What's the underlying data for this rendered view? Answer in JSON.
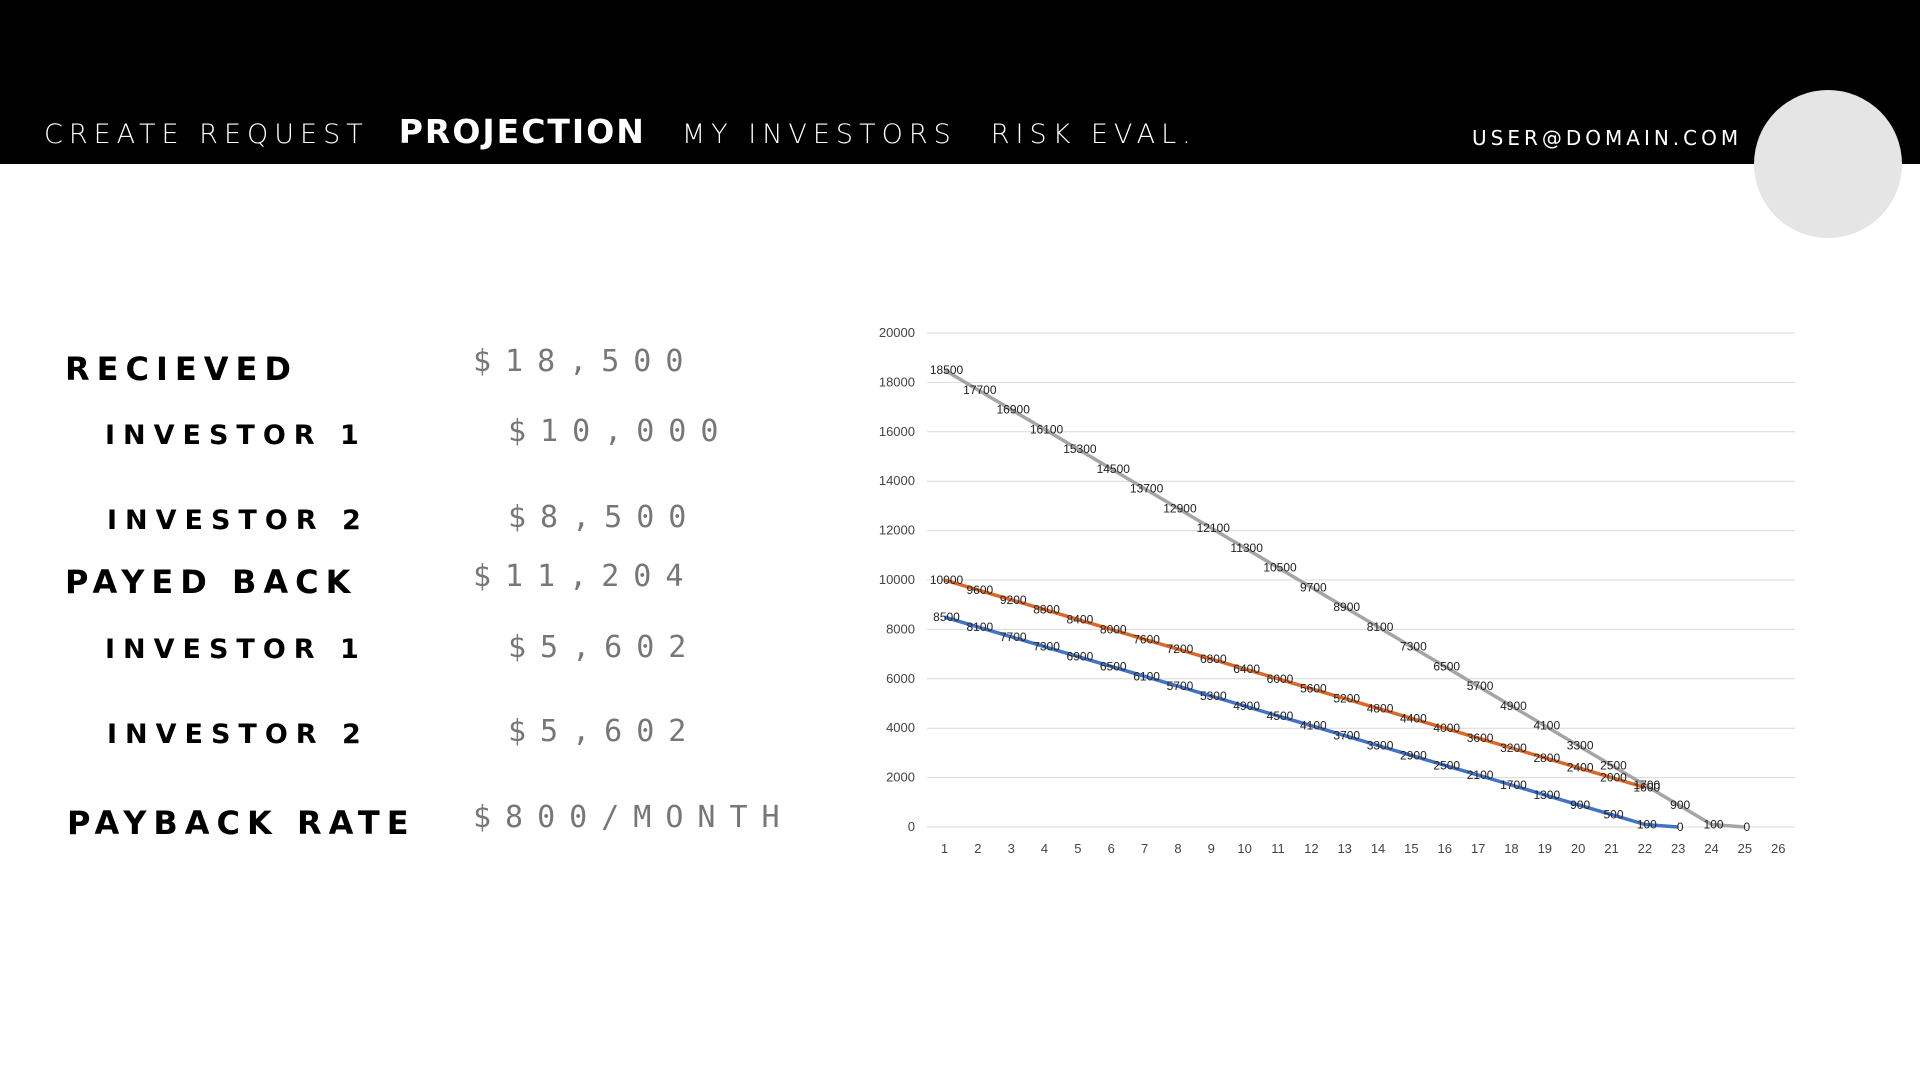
{
  "nav": {
    "items": [
      {
        "label": "CREATE REQUEST",
        "active": false
      },
      {
        "label": "PROJECTION",
        "active": true
      },
      {
        "label": "MY INVESTORS",
        "active": false
      },
      {
        "label": "RISK EVAL.",
        "active": false
      }
    ],
    "user_email": "USER@DOMAIN.COM"
  },
  "summary": {
    "received": {
      "label": "RECIEVED",
      "value": "$18,500"
    },
    "received_investor1": {
      "label": "INVESTOR 1",
      "value": "$10,000"
    },
    "received_investor2": {
      "label": "INVESTOR 2",
      "value": "$8,500"
    },
    "payed_back": {
      "label": "PAYED BACK",
      "value": "$11,204"
    },
    "payed_investor1": {
      "label": "INVESTOR 1",
      "value": "$5,602"
    },
    "payed_investor2": {
      "label": "INVESTOR 2",
      "value": "$5,602"
    },
    "payback_rate": {
      "label": "PAYBACK RATE",
      "value": "$800/MONTH"
    }
  },
  "colors": {
    "topbar": "#000000",
    "series_gray": "#a5a5a5",
    "series_orange": "#d9692a",
    "series_blue": "#4472c4",
    "avatar": "#e5e5e5"
  },
  "chart_data": {
    "type": "line",
    "title": "",
    "xlabel": "",
    "ylabel": "",
    "x": [
      1,
      2,
      3,
      4,
      5,
      6,
      7,
      8,
      9,
      10,
      11,
      12,
      13,
      14,
      15,
      16,
      17,
      18,
      19,
      20,
      21,
      22,
      23,
      24,
      25,
      26
    ],
    "ylim": [
      0,
      20000
    ],
    "yticks": [
      0,
      2000,
      4000,
      6000,
      8000,
      10000,
      12000,
      14000,
      16000,
      18000,
      20000
    ],
    "grid": true,
    "series": [
      {
        "color": "#a5a5a5",
        "x": [
          1,
          2,
          3,
          4,
          5,
          6,
          7,
          8,
          9,
          10,
          11,
          12,
          13,
          14,
          15,
          16,
          17,
          18,
          19,
          20,
          21,
          22,
          23,
          24,
          25
        ],
        "values": [
          18500,
          17700,
          16900,
          16100,
          15300,
          14500,
          13700,
          12900,
          12100,
          11300,
          10500,
          9700,
          8900,
          8100,
          7300,
          6500,
          5700,
          4900,
          4100,
          3300,
          2500,
          1700,
          900,
          100,
          0
        ]
      },
      {
        "color": "#d9692a",
        "x": [
          1,
          2,
          3,
          4,
          5,
          6,
          7,
          8,
          9,
          10,
          11,
          12,
          13,
          14,
          15,
          16,
          17,
          18,
          19,
          20,
          21,
          22
        ],
        "values": [
          10000,
          9600,
          9200,
          8800,
          8400,
          8000,
          7600,
          7200,
          6800,
          6400,
          6000,
          5600,
          5200,
          4800,
          4400,
          4000,
          3600,
          3200,
          2800,
          2400,
          2000,
          1600
        ]
      },
      {
        "color": "#4472c4",
        "x": [
          1,
          2,
          3,
          4,
          5,
          6,
          7,
          8,
          9,
          10,
          11,
          12,
          13,
          14,
          15,
          16,
          17,
          18,
          19,
          20,
          21,
          22,
          23
        ],
        "values": [
          8500,
          8100,
          7700,
          7300,
          6900,
          6500,
          6100,
          5700,
          5300,
          4900,
          4500,
          4100,
          3700,
          3300,
          2900,
          2500,
          2100,
          1700,
          1300,
          900,
          500,
          100,
          0
        ]
      }
    ]
  }
}
